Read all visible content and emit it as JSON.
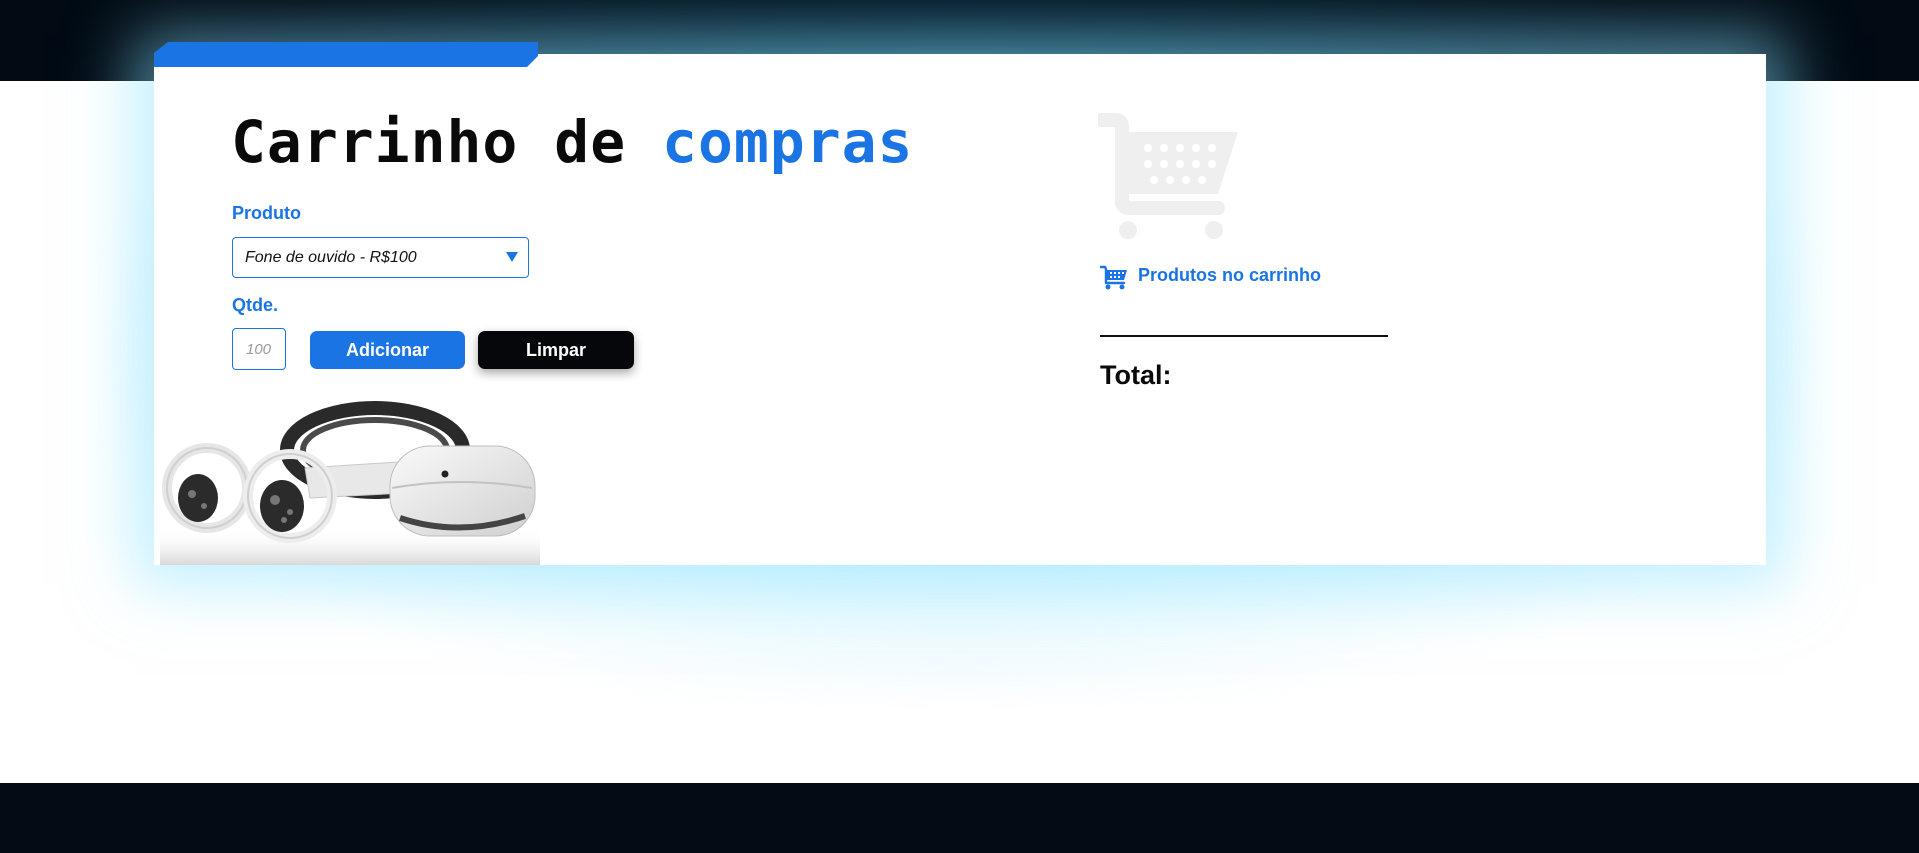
{
  "page": {
    "title_main": "Carrinho de",
    "title_accent": "compras",
    "accent_color": "#1b74e4"
  },
  "form": {
    "product_label": "Produto",
    "product_selected": "Fone de ouvido - R$100",
    "quantity_label": "Qtde.",
    "quantity_placeholder": "100",
    "add_button": "Adicionar",
    "clear_button": "Limpar"
  },
  "cart": {
    "heading": "Produtos no carrinho",
    "total_label": "Total:",
    "icon": "shopping-cart-icon"
  },
  "product_image": {
    "icon": "vr-headset-illustration"
  }
}
